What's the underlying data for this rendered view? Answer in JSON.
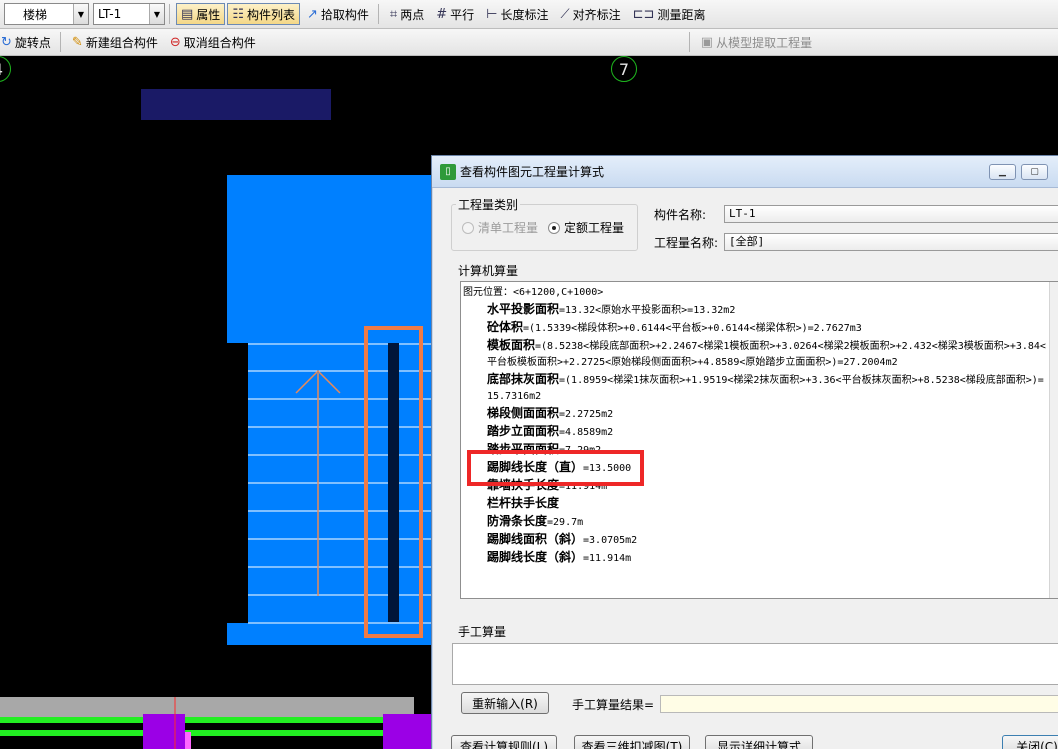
{
  "toolbar1": {
    "combo_type": "楼梯",
    "combo_name": "LT-1",
    "attr_label": "属性",
    "list_label": "构件列表",
    "pick_label": "拾取构件",
    "twopoint_label": "两点",
    "parallel_label": "平行",
    "length_dim_label": "长度标注",
    "align_dim_label": "对齐标注",
    "measure_label": "测量距离"
  },
  "toolbar2": {
    "rotate_label": "旋转点",
    "new_group_label": "新建组合构件",
    "cancel_group_label": "取消组合构件",
    "extract_label": "从模型提取工程量"
  },
  "canvas": {
    "axis_left": "4",
    "axis_right": "7",
    "colors": {
      "stair_blue": "#0080ff",
      "label_bar": "#1a1a66",
      "handrail_orange": "#f07b45",
      "grid_gray": "#a8a8a8",
      "green": "#22ee22",
      "purple": "#9b00e6",
      "arrow": "#e88a5a"
    }
  },
  "dialog": {
    "title": "查看构件图元工程量计算式",
    "quantity_type_group": "工程量类别",
    "radio_list": "清单工程量",
    "radio_quota": "定额工程量",
    "name_label": "构件名称:",
    "name_value": "LT-1",
    "qty_name_label": "工程量名称:",
    "qty_name_value": "[全部]",
    "computer_calc_label": "计算机算量",
    "lines": [
      {
        "bold": "",
        "text": "图元位置：<6+1200,C+1000>",
        "indent": false
      },
      {
        "bold": "水平投影面积",
        "text": "=13.32<原始水平投影面积>=13.32m2",
        "indent": true
      },
      {
        "bold": "砼体积",
        "text": "=(1.5339<梯段体积>+0.6144<平台板>+0.6144<梯梁体积>)=2.7627m3",
        "indent": true
      },
      {
        "bold": "模板面积",
        "text": "=(8.5238<梯段底部面积>+2.2467<梯梁1模板面积>+3.0264<梯梁2模板面积>+2.432<梯梁3模板面积>+3.84<平台板模板面积>+2.2725<原始梯段侧面面积>+4.8589<原始踏步立面面积>)=27.2004m2",
        "indent": true
      },
      {
        "bold": "底部抹灰面积",
        "text": "=(1.8959<梯梁1抹灰面积>+1.9519<梯梁2抹灰面积>+3.36<平台板抹灰面积>+8.5238<梯段底部面积>)=15.7316m2",
        "indent": true
      },
      {
        "bold": "梯段侧面面积",
        "text": "=2.2725m2",
        "indent": true
      },
      {
        "bold": "踏步立面面积",
        "text": "=4.8589m2",
        "indent": true
      },
      {
        "bold": "踏步平面面积",
        "text": "=7.29m2",
        "indent": true
      },
      {
        "bold": "踢脚线长度（直）",
        "text": "=13.5000",
        "indent": true
      },
      {
        "bold": "靠墙扶手长度",
        "text": "=11.914m",
        "indent": true
      },
      {
        "bold": "栏杆扶手长度",
        "text": "",
        "indent": true
      },
      {
        "bold": "防滑条长度",
        "text": "=29.7m",
        "indent": true
      },
      {
        "bold": "踢脚线面积（斜）",
        "text": "=3.0705m2",
        "indent": true
      },
      {
        "bold": "踢脚线长度（斜）",
        "text": "=11.914m",
        "indent": true
      }
    ],
    "manual_calc_label": "手工算量",
    "reinput_button": "重新输入(R)",
    "manual_result_label": "手工算量结果=",
    "view_rules_button": "查看计算规则(L)",
    "view_3d_button": "查看三维扣减图(T)",
    "show_detail_button": "显示详细计算式",
    "close_button": "关闭(C)"
  }
}
